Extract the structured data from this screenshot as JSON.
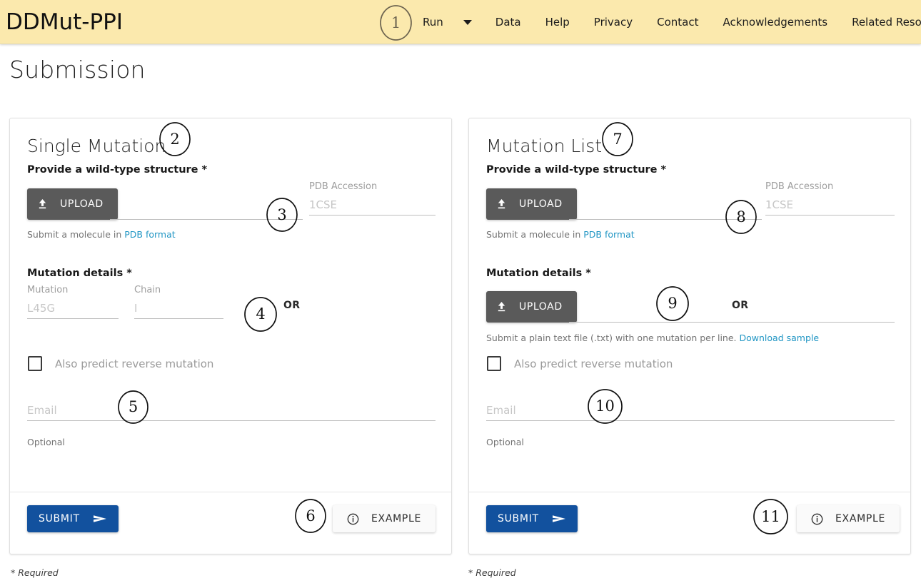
{
  "header": {
    "brand": "DDMut-PPI",
    "nav": [
      {
        "label": "Run",
        "has_dropdown": true
      },
      {
        "label": "Data"
      },
      {
        "label": "Help"
      },
      {
        "label": "Privacy"
      },
      {
        "label": "Contact"
      },
      {
        "label": "Acknowledgements"
      },
      {
        "label": "Related Resources"
      }
    ],
    "background_color": "#fbe9ad"
  },
  "page": {
    "title": "Submission",
    "required_note": "* Required"
  },
  "cards": [
    {
      "heading": "Single Mutation",
      "structure_legend": "Provide a wild-type structure *",
      "upload_label": "UPLOAD",
      "or_label": "OR",
      "pdb_accession_label": "PDB Accession",
      "pdb_accession_placeholder": "1CSE",
      "structure_hint_text": "Submit a molecule in ",
      "structure_hint_link": "PDB format",
      "mutation_legend": "Mutation details *",
      "mutation_label": "Mutation",
      "mutation_placeholder": "L45G",
      "chain_label": "Chain",
      "chain_placeholder": "I",
      "checkbox_label": "Also predict reverse mutation",
      "email_placeholder": "Email",
      "email_hint": "Optional",
      "submit_label": "SUBMIT",
      "example_label": "EXAMPLE"
    },
    {
      "heading": "Mutation List",
      "structure_legend": "Provide a wild-type structure *",
      "upload_label": "UPLOAD",
      "or_label": "OR",
      "pdb_accession_label": "PDB Accession",
      "pdb_accession_placeholder": "1CSE",
      "structure_hint_text": "Submit a molecule in ",
      "structure_hint_link": "PDB format",
      "mutation_legend": "Mutation details *",
      "list_upload_label": "UPLOAD",
      "list_hint_text": "Submit a plain text file (.txt) with one mutation per line. ",
      "list_hint_link": "Download sample",
      "checkbox_label": "Also predict reverse mutation",
      "email_placeholder": "Email",
      "email_hint": "Optional",
      "submit_label": "SUBMIT",
      "example_label": "EXAMPLE"
    }
  ],
  "annotations": [
    {
      "number": "1"
    },
    {
      "number": "2"
    },
    {
      "number": "3"
    },
    {
      "number": "4"
    },
    {
      "number": "5"
    },
    {
      "number": "6"
    },
    {
      "number": "7"
    },
    {
      "number": "8"
    },
    {
      "number": "9"
    },
    {
      "number": "10"
    },
    {
      "number": "11"
    }
  ],
  "colors": {
    "header_bg": "#fbe9ad",
    "submit_blue": "#12519e",
    "upload_gray": "#5a5a5a",
    "link_blue": "#2196c4"
  }
}
